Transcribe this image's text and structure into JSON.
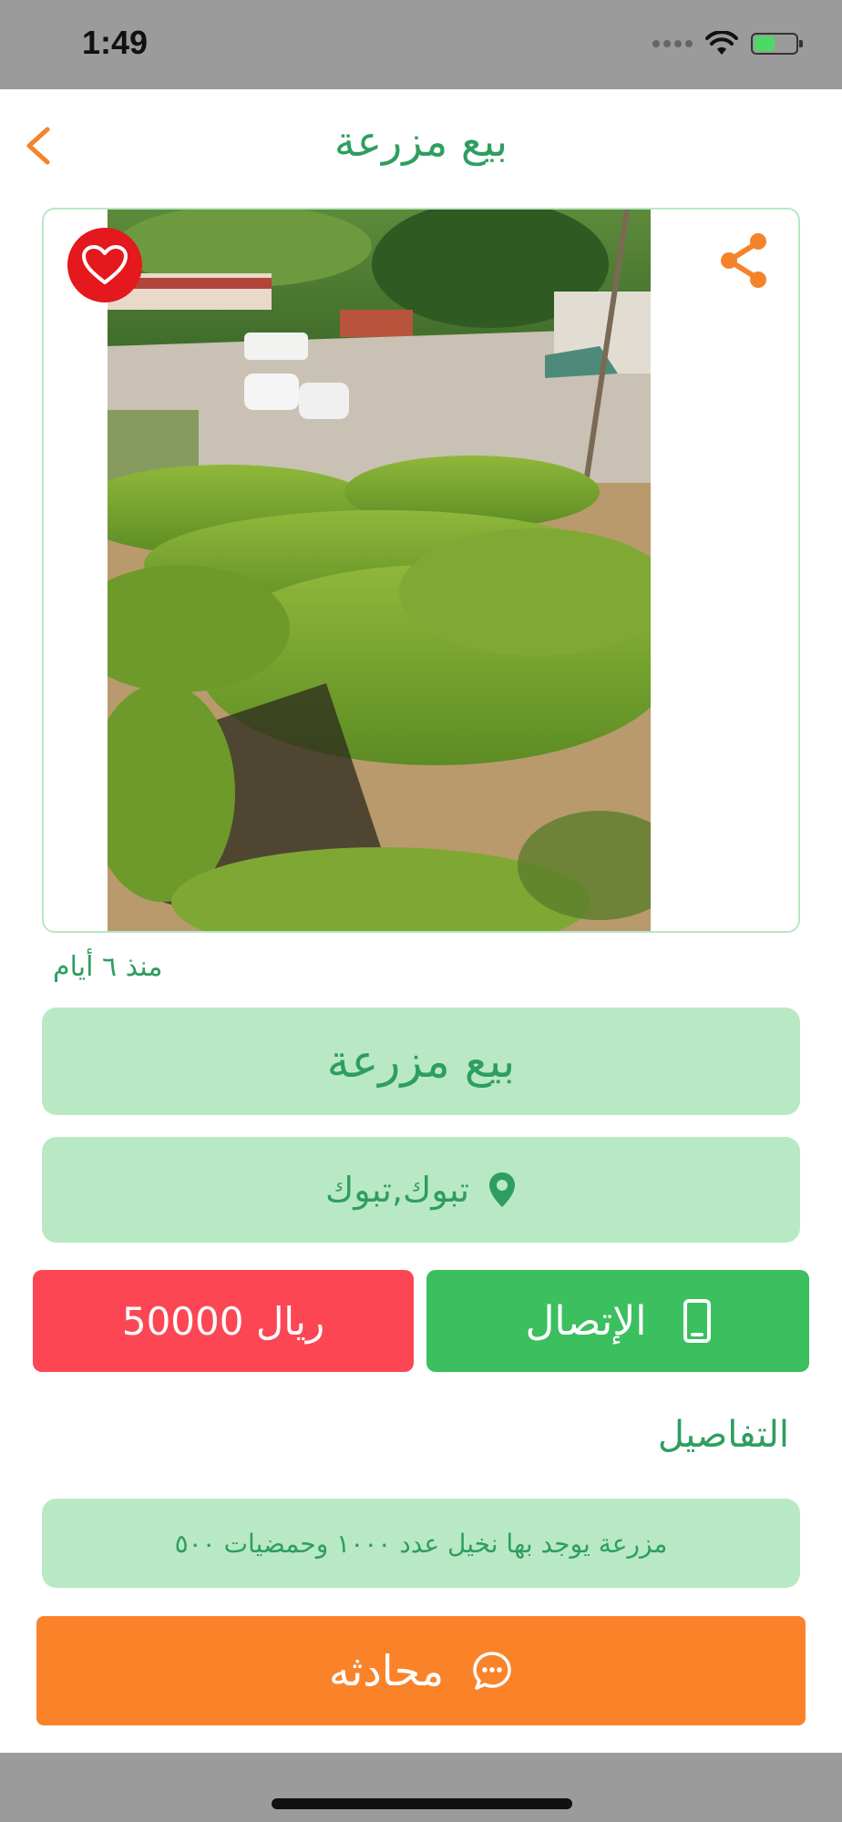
{
  "status_bar": {
    "time": "1:49"
  },
  "nav": {
    "title": "بيع مزرعة",
    "back_icon": "chevron-left-icon"
  },
  "listing": {
    "photo_alt": "",
    "favorite_icon": "heart-icon",
    "share_icon": "share-icon",
    "posted": "منذ ٦ أيام",
    "title": "بيع مزرعة",
    "location": "تبوك,تبوك",
    "price": "50000 ريال",
    "call_label": "الإتصال",
    "details_heading": "التفاصيل",
    "description": "مزرعة يوجد بها نخيل عدد ١٠٠٠ وحمضيات ٥٠٠",
    "chat_label": "محادثه"
  },
  "colors": {
    "accent_green": "#2e9e5f",
    "pill_green": "#b8e9c4",
    "call_green": "#3bbf5f",
    "price_red": "#fc4654",
    "chat_orange": "#fa832a"
  }
}
